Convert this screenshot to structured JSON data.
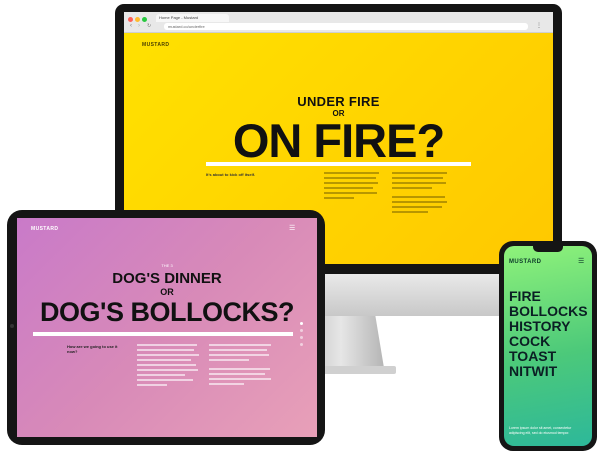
{
  "desktop": {
    "tab_title": "Home Page - Mustard",
    "url": "mustard.co/underfire",
    "logo": "MUSTARD",
    "kicker": "UNDER FIRE",
    "or": "OR",
    "headline": "ON FIRE?",
    "lede": "It's about to kick off itself.",
    "browser_dots": [
      "#ff5f57",
      "#febc2e",
      "#28c840"
    ],
    "accent": "#ffd200"
  },
  "tablet": {
    "logo": "MUSTARD",
    "kicker_small": "THE 3",
    "kicker": "DOG'S DINNER",
    "or": "OR",
    "headline": "DOG'S BOLLOCKS?",
    "lede": "How are we going to use it now?",
    "accent": "#d68cc4"
  },
  "phone": {
    "logo": "MUSTARD",
    "words": [
      "FIRE",
      "BOLLOCKS",
      "HISTORY",
      "COCK",
      "TOAST",
      "NITWIT"
    ],
    "caption": "Lorem ipsum dolor sit amet, consectetur adipiscing elit, sed do eiusmod tempor.",
    "accent": "#5fd67a"
  }
}
